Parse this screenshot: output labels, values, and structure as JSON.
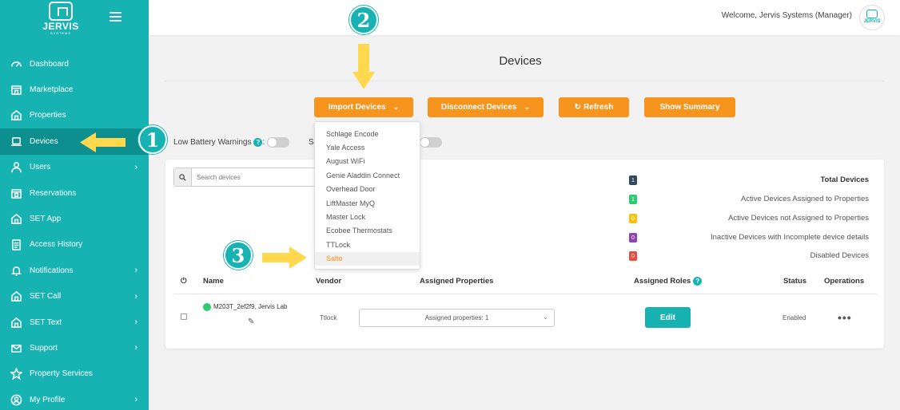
{
  "brand": {
    "name": "JERVIS",
    "sub": "SYSTEMS"
  },
  "sidebar": {
    "items": [
      {
        "label": "Dashboard",
        "icon": "dashboard-icon",
        "chevron": false,
        "active": false
      },
      {
        "label": "Marketplace",
        "icon": "store-icon",
        "chevron": false,
        "active": false
      },
      {
        "label": "Properties",
        "icon": "home-icon",
        "chevron": false,
        "active": false
      },
      {
        "label": "Devices",
        "icon": "laptop-icon",
        "chevron": false,
        "active": true
      },
      {
        "label": "Users",
        "icon": "user-icon",
        "chevron": true,
        "active": false
      },
      {
        "label": "Reservations",
        "icon": "calendar-icon",
        "chevron": false,
        "active": false
      },
      {
        "label": "SET App",
        "icon": "home-icon",
        "chevron": false,
        "active": false
      },
      {
        "label": "Access History",
        "icon": "clipboard-icon",
        "chevron": false,
        "active": false
      },
      {
        "label": "Notifications",
        "icon": "bell-icon",
        "chevron": true,
        "active": false
      },
      {
        "label": "SET Call",
        "icon": "home-icon",
        "chevron": true,
        "active": false
      },
      {
        "label": "SET Text",
        "icon": "home-icon",
        "chevron": true,
        "active": false
      },
      {
        "label": "Support",
        "icon": "mail-icon",
        "chevron": true,
        "active": false
      },
      {
        "label": "Property Services",
        "icon": "star-icon",
        "chevron": false,
        "active": false
      },
      {
        "label": "My Profile",
        "icon": "profile-icon",
        "chevron": true,
        "active": false
      }
    ]
  },
  "header": {
    "welcome": "Welcome, Jervis Systems (Manager)",
    "avatar_text": "JERVIS"
  },
  "page": {
    "title": "Devices"
  },
  "toolbar": {
    "import_label": "Import Devices",
    "disconnect_label": "Disconnect Devices",
    "refresh_label": "Refresh",
    "summary_label": "Show Summary"
  },
  "toggles": {
    "low_battery_label": "Low Battery Warnings",
    "colon": ":",
    "second_label_partial": "S"
  },
  "search": {
    "placeholder": "Search devices"
  },
  "import_menu": {
    "items": [
      "Schlage Encode",
      "Yale Access",
      "August WiFi",
      "Genie Aladdin Connect",
      "Overhead Door",
      "LiftMaster MyQ",
      "Master Lock",
      "Ecobee Thermostats",
      "TTLock",
      "Salto"
    ],
    "hovered": "Salto"
  },
  "legend": [
    {
      "count": "1",
      "label": "Total Devices",
      "color": "#34495e"
    },
    {
      "count": "1",
      "label": "Active Devices Assigned to Properties",
      "color": "#2ecc71"
    },
    {
      "count": "0",
      "label": "Active Devices not Assigned to Properties",
      "color": "#f1c40f"
    },
    {
      "count": "0",
      "label": "Inactive Devices with Incomplete device details",
      "color": "#8e44ad"
    },
    {
      "count": "0",
      "label": "Disabled Devices",
      "color": "#e74c3c"
    }
  ],
  "table": {
    "headers": {
      "power": "⏻",
      "name": "Name",
      "vendor": "Vendor",
      "assigned_properties": "Assigned Properties",
      "assigned_roles": "Assigned Roles",
      "status": "Status",
      "operations": "Operations"
    },
    "rows": [
      {
        "name": "M203T_2ef2f9, Jervis Lab",
        "vendor": "Ttlock",
        "assigned": "Assigned properties: 1",
        "edit": "Edit",
        "status": "Enabled",
        "ops": "•••"
      }
    ]
  },
  "annotations": {
    "step1": "1",
    "step2": "2",
    "step3": "3"
  },
  "colors": {
    "accent": "#17b3b3",
    "orange": "#f7941d",
    "arrow": "#ffd84d"
  }
}
